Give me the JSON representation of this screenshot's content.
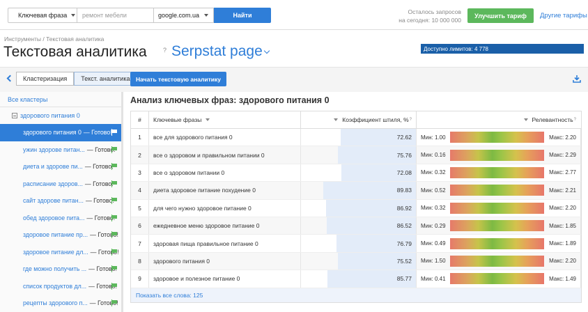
{
  "search": {
    "type_label": "Ключевая фраза",
    "query_placeholder": "ремонт мебели",
    "domain": "google.com.ua",
    "find_label": "Найти"
  },
  "quota": {
    "line1": "Осталось запросов",
    "line2": "на сегодня: 10 000 000"
  },
  "header": {
    "upgrade_label": "Улучшить тариф",
    "other_tariffs": "Другие тарифы"
  },
  "breadcrumb": "Инструменты / Текстовая аналитика",
  "page": {
    "title": "Текстовая аналитика",
    "help": "?",
    "project": "Serpstat page",
    "limits": "Доступно лимитов: 4 778"
  },
  "toolbar": {
    "tab_clustering": "Кластеризация",
    "tab_text": "Текст. аналитика",
    "start_label": "Начать текстовую аналитику"
  },
  "sidebar": {
    "all_clusters": "Все кластеры",
    "group": "здорового питания 0",
    "items": [
      {
        "label": "здорового питания 0",
        "status": "— Готово!"
      },
      {
        "label": "ужин здорове питан...",
        "status": "— Готово!"
      },
      {
        "label": "диета и здорове пи...",
        "status": "— Готово!"
      },
      {
        "label": "расписание здоров...",
        "status": "— Готово!"
      },
      {
        "label": "сайт здорове питан...",
        "status": "— Готово!"
      },
      {
        "label": "обед здоровое пита...",
        "status": "— Готово!"
      },
      {
        "label": "здоровое питание пр...",
        "status": "— Готово!"
      },
      {
        "label": "здоровое питание дл...",
        "status": "— Готово!"
      },
      {
        "label": "где можно получить ...",
        "status": "— Готово!"
      },
      {
        "label": "список продуктов дл...",
        "status": "— Готово!"
      },
      {
        "label": "рецепты здорового п...",
        "status": "— Готово!"
      }
    ]
  },
  "main": {
    "heading": "Анализ ключевых фраз: здорового питания 0",
    "columns": {
      "num": "#",
      "keyword": "Ключевые фразы",
      "coef": "Коэффициент штиля, %",
      "coef_help": "?",
      "rel": "Релевантность",
      "rel_help": "?"
    },
    "rows": [
      {
        "n": "1",
        "kw": "все для здорового питания 0",
        "coef": "72.62",
        "coef_pct": 72.62,
        "min": "Мин: 1.00",
        "max": "Макс: 2.20"
      },
      {
        "n": "2",
        "kw": "все о здоровом и правильном питании 0",
        "coef": "75.76",
        "coef_pct": 75.76,
        "min": "Мин: 0.16",
        "max": "Макс: 2.29"
      },
      {
        "n": "3",
        "kw": "все о здоровом питании 0",
        "coef": "72.08",
        "coef_pct": 72.08,
        "min": "Мин: 0.32",
        "max": "Макс: 2.77"
      },
      {
        "n": "4",
        "kw": "диета здоровое питание похудение 0",
        "coef": "89.83",
        "coef_pct": 89.83,
        "min": "Мин: 0.52",
        "max": "Макс: 2.21"
      },
      {
        "n": "5",
        "kw": "для чего нужно здоровое питание 0",
        "coef": "86.92",
        "coef_pct": 86.92,
        "min": "Мин: 0.32",
        "max": "Макс: 2.20"
      },
      {
        "n": "6",
        "kw": "ежедневное меню здоровое питание 0",
        "coef": "86.52",
        "coef_pct": 86.52,
        "min": "Мин: 0.29",
        "max": "Макс: 1.85"
      },
      {
        "n": "7",
        "kw": "здоровая пища правильное питание 0",
        "coef": "76.79",
        "coef_pct": 76.79,
        "min": "Мин: 0.49",
        "max": "Макс: 1.89"
      },
      {
        "n": "8",
        "kw": "здорового питания 0",
        "coef": "75.52",
        "coef_pct": 75.52,
        "min": "Мин: 1.50",
        "max": "Макс: 2.20"
      },
      {
        "n": "9",
        "kw": "здоровое и полезное питание 0",
        "coef": "85.77",
        "coef_pct": 85.77,
        "min": "Мин: 0.41",
        "max": "Макс: 1.49"
      }
    ],
    "show_all": "Показать все слова: 125"
  }
}
